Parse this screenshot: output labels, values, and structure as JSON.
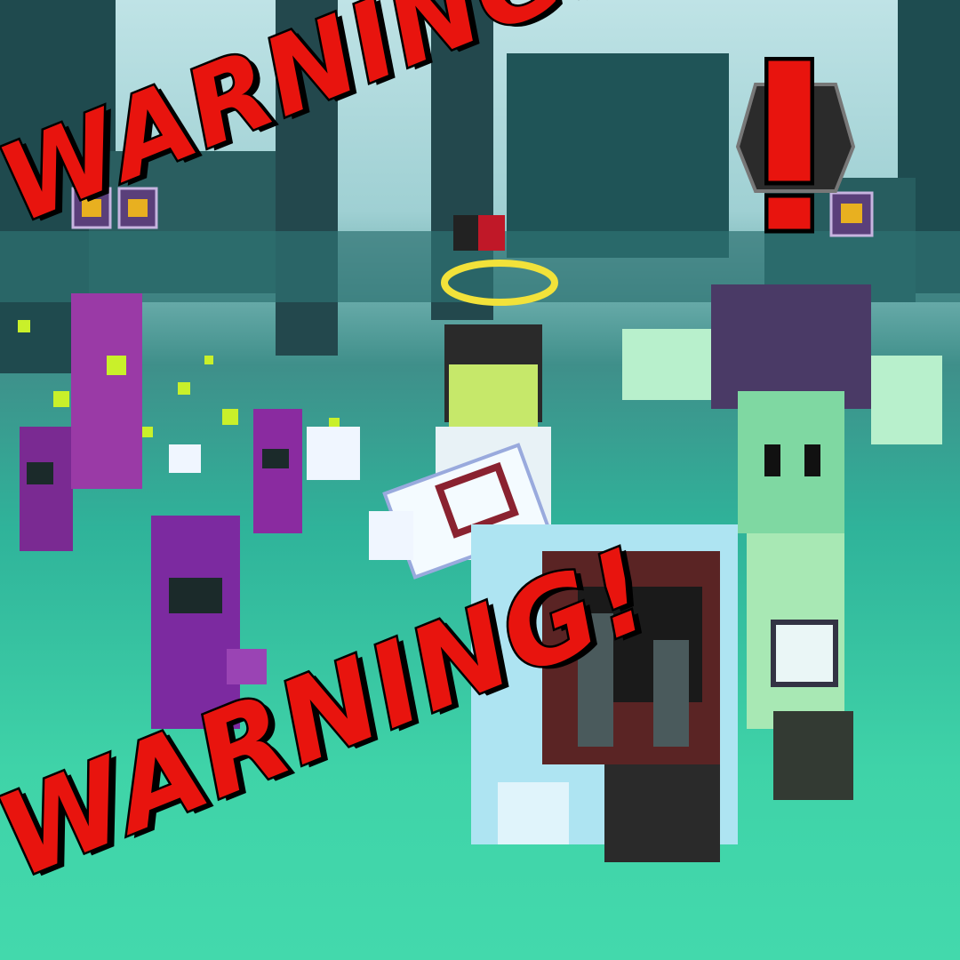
{
  "game": {
    "warning_top": "WARNING!",
    "warning_bottom": "WARNING!",
    "alert_icon": "exclamation-alert-icon",
    "colors": {
      "warning_text": "#e8140e",
      "outline": "#000000",
      "ground": "#3fd3a8",
      "trees": "#1f4f52",
      "cultist_robe": "#8a2ba0",
      "zombie_skin": "#9fe3b4",
      "ice_block": "#aee4f2"
    },
    "hud_icons": [
      "gold-cubes-badge-icon",
      "gold-cubes-badge-icon",
      "gold-cubes-badge-icon",
      "broken-heart-icon",
      "halo-icon"
    ]
  }
}
